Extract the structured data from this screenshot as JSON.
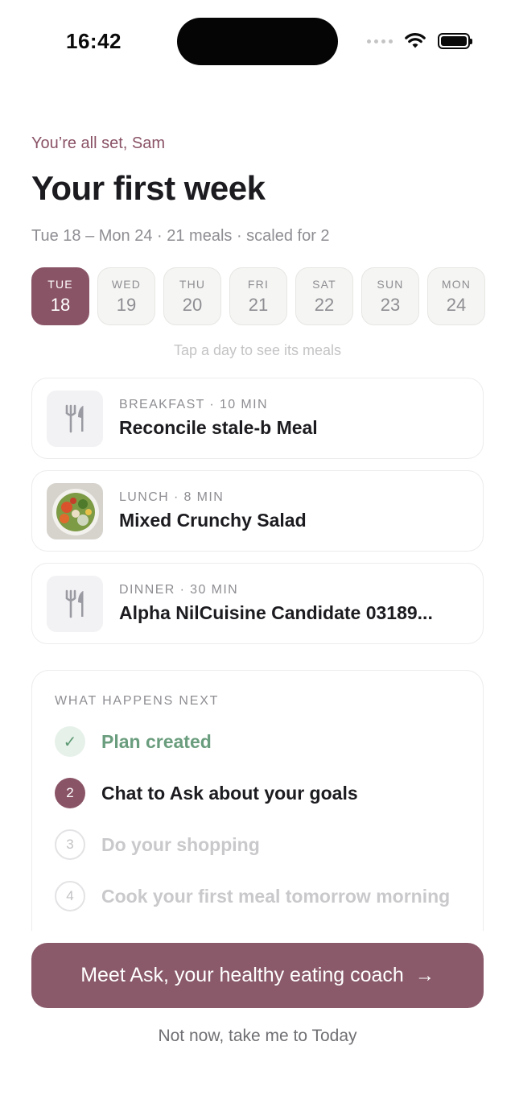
{
  "status_bar": {
    "time": "16:42"
  },
  "header": {
    "eyebrow": "You’re all set, Sam",
    "title": "Your first week",
    "subtitle": "Tue 18 – Mon 24 · 21 meals · scaled for 2"
  },
  "days": [
    {
      "dow": "TUE",
      "num": "18",
      "selected": true
    },
    {
      "dow": "WED",
      "num": "19"
    },
    {
      "dow": "THU",
      "num": "20"
    },
    {
      "dow": "FRI",
      "num": "21"
    },
    {
      "dow": "SAT",
      "num": "22"
    },
    {
      "dow": "SUN",
      "num": "23"
    },
    {
      "dow": "MON",
      "num": "24"
    }
  ],
  "day_hint": "Tap a day to see its meals",
  "meals": [
    {
      "meta": "BREAKFAST · 10 MIN",
      "name": "Reconcile stale-b Meal",
      "icon": "fork-knife-icon"
    },
    {
      "meta": "LUNCH · 8 MIN",
      "name": "Mixed Crunchy Salad",
      "icon": "salad-photo"
    },
    {
      "meta": "DINNER · 30 MIN",
      "name": "Alpha NilCuisine Candidate 03189...",
      "icon": "fork-knife-icon"
    }
  ],
  "next_steps": {
    "heading": "WHAT HAPPENS NEXT",
    "steps": [
      {
        "mark": "✓",
        "label": "Plan created",
        "state": "done"
      },
      {
        "mark": "2",
        "label": "Chat to Ask about your goals",
        "state": "current"
      },
      {
        "mark": "3",
        "label": "Do your shopping",
        "state": "upcoming"
      },
      {
        "mark": "4",
        "label": "Cook your first meal tomorrow morning",
        "state": "upcoming"
      }
    ]
  },
  "cta": {
    "label": "Meet Ask, your healthy eating coach",
    "arrow": "→"
  },
  "secondary": {
    "label": "Not now, take me to Today"
  },
  "colors": {
    "accent": "#8a5467",
    "success": "#6a9d7d"
  }
}
